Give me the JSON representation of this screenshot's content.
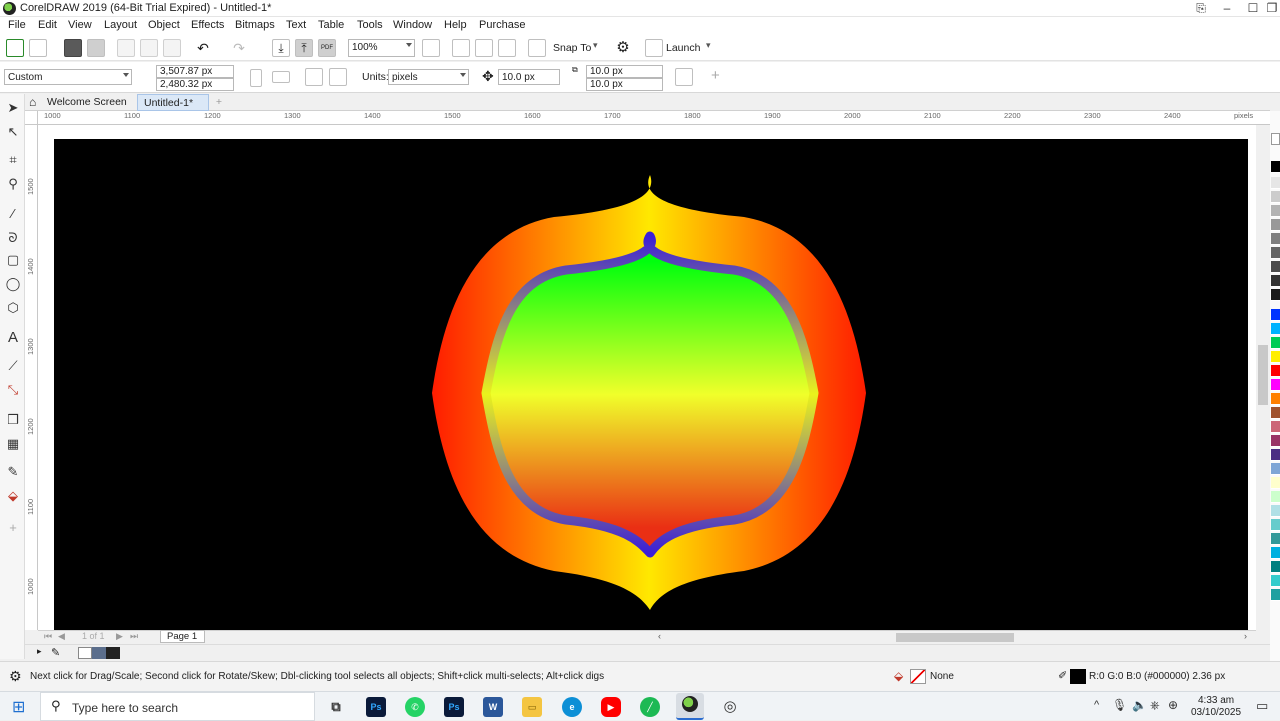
{
  "window": {
    "title": "CorelDRAW 2019 (64-Bit Trial Expired) - Untitled-1*"
  },
  "menu": [
    "File",
    "Edit",
    "View",
    "Layout",
    "Object",
    "Effects",
    "Bitmaps",
    "Text",
    "Table",
    "Tools",
    "Window",
    "Help",
    "Purchase"
  ],
  "toolbar": {
    "zoom": "100%",
    "snap_label": "Snap To",
    "launch_label": "Launch"
  },
  "property_bar": {
    "preset": "Custom",
    "width": "3,507.87 px",
    "height": "2,480.32 px",
    "units_label": "Units:",
    "units_value": "pixels",
    "nudge": "10.0 px",
    "dup_x": "10.0 px",
    "dup_y": "10.0 px"
  },
  "tabs": [
    "Welcome Screen",
    "Untitled-1*"
  ],
  "ruler": {
    "h_ticks": [
      "1000",
      "1100",
      "1200",
      "1300",
      "1400",
      "1500",
      "1600",
      "1700",
      "1800",
      "1900",
      "2000",
      "2100",
      "2200",
      "2300",
      "2400"
    ],
    "h_unit": "pixels",
    "v_ticks": [
      "1500",
      "1400",
      "1300",
      "1200",
      "1100",
      "1000"
    ]
  },
  "pagebar": {
    "counter": "1 of 1",
    "page_tab": "Page 1"
  },
  "status": {
    "hint": "Next click for Drag/Scale; Second click for Rotate/Skew; Dbl-clicking tool selects all objects; Shift+click multi-selects; Alt+click digs",
    "fill": "None",
    "outline": "R:0 G:0 B:0 (#000000)  2.36 px"
  },
  "taskbar": {
    "search_placeholder": "Type here to search",
    "time": "4:33 am",
    "date": "03/10/2025"
  },
  "colors": {
    "outer_gradient": [
      "#ff1c00",
      "#ffe800",
      "#ff1c00"
    ],
    "stroke_gradient": [
      "#3b1fd8",
      "#eaf21c",
      "#3b1fd8"
    ],
    "inner_gradient": [
      "#00ff0d",
      "#f0ff2a",
      "#ea2f14"
    ]
  }
}
